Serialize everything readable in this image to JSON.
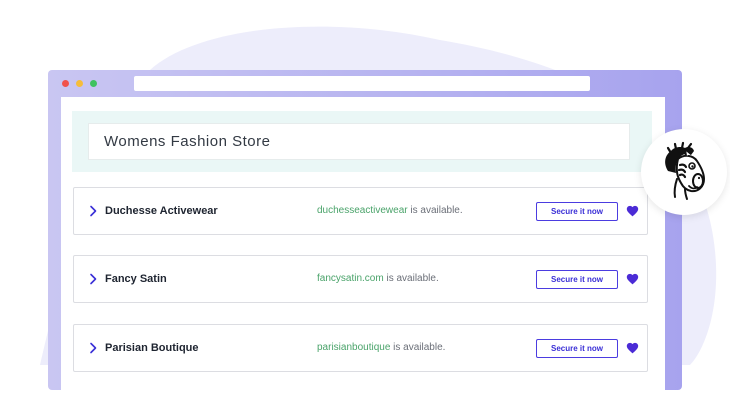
{
  "search": {
    "value": "Womens Fashion Store"
  },
  "results": [
    {
      "name": "Duchesse Activewear",
      "domain": "duchesseactivewear",
      "availability": " is available.",
      "action": "Secure it now"
    },
    {
      "name": "Fancy Satin",
      "domain": "fancysatin.com",
      "availability": " is available.",
      "action": "Secure it now"
    },
    {
      "name": "Parisian Boutique",
      "domain": "parisianboutique",
      "availability": " is available.",
      "action": "Secure it now"
    }
  ],
  "colors": {
    "accent": "#3a2fd6",
    "domain_green": "#4aa36a",
    "browser_frame": "#b5b2f0",
    "search_band": "#eaf7f6"
  },
  "icons": {
    "expand": "chevron-right-icon",
    "favorite": "heart-icon",
    "mascot": "zebra-mascot-icon"
  }
}
